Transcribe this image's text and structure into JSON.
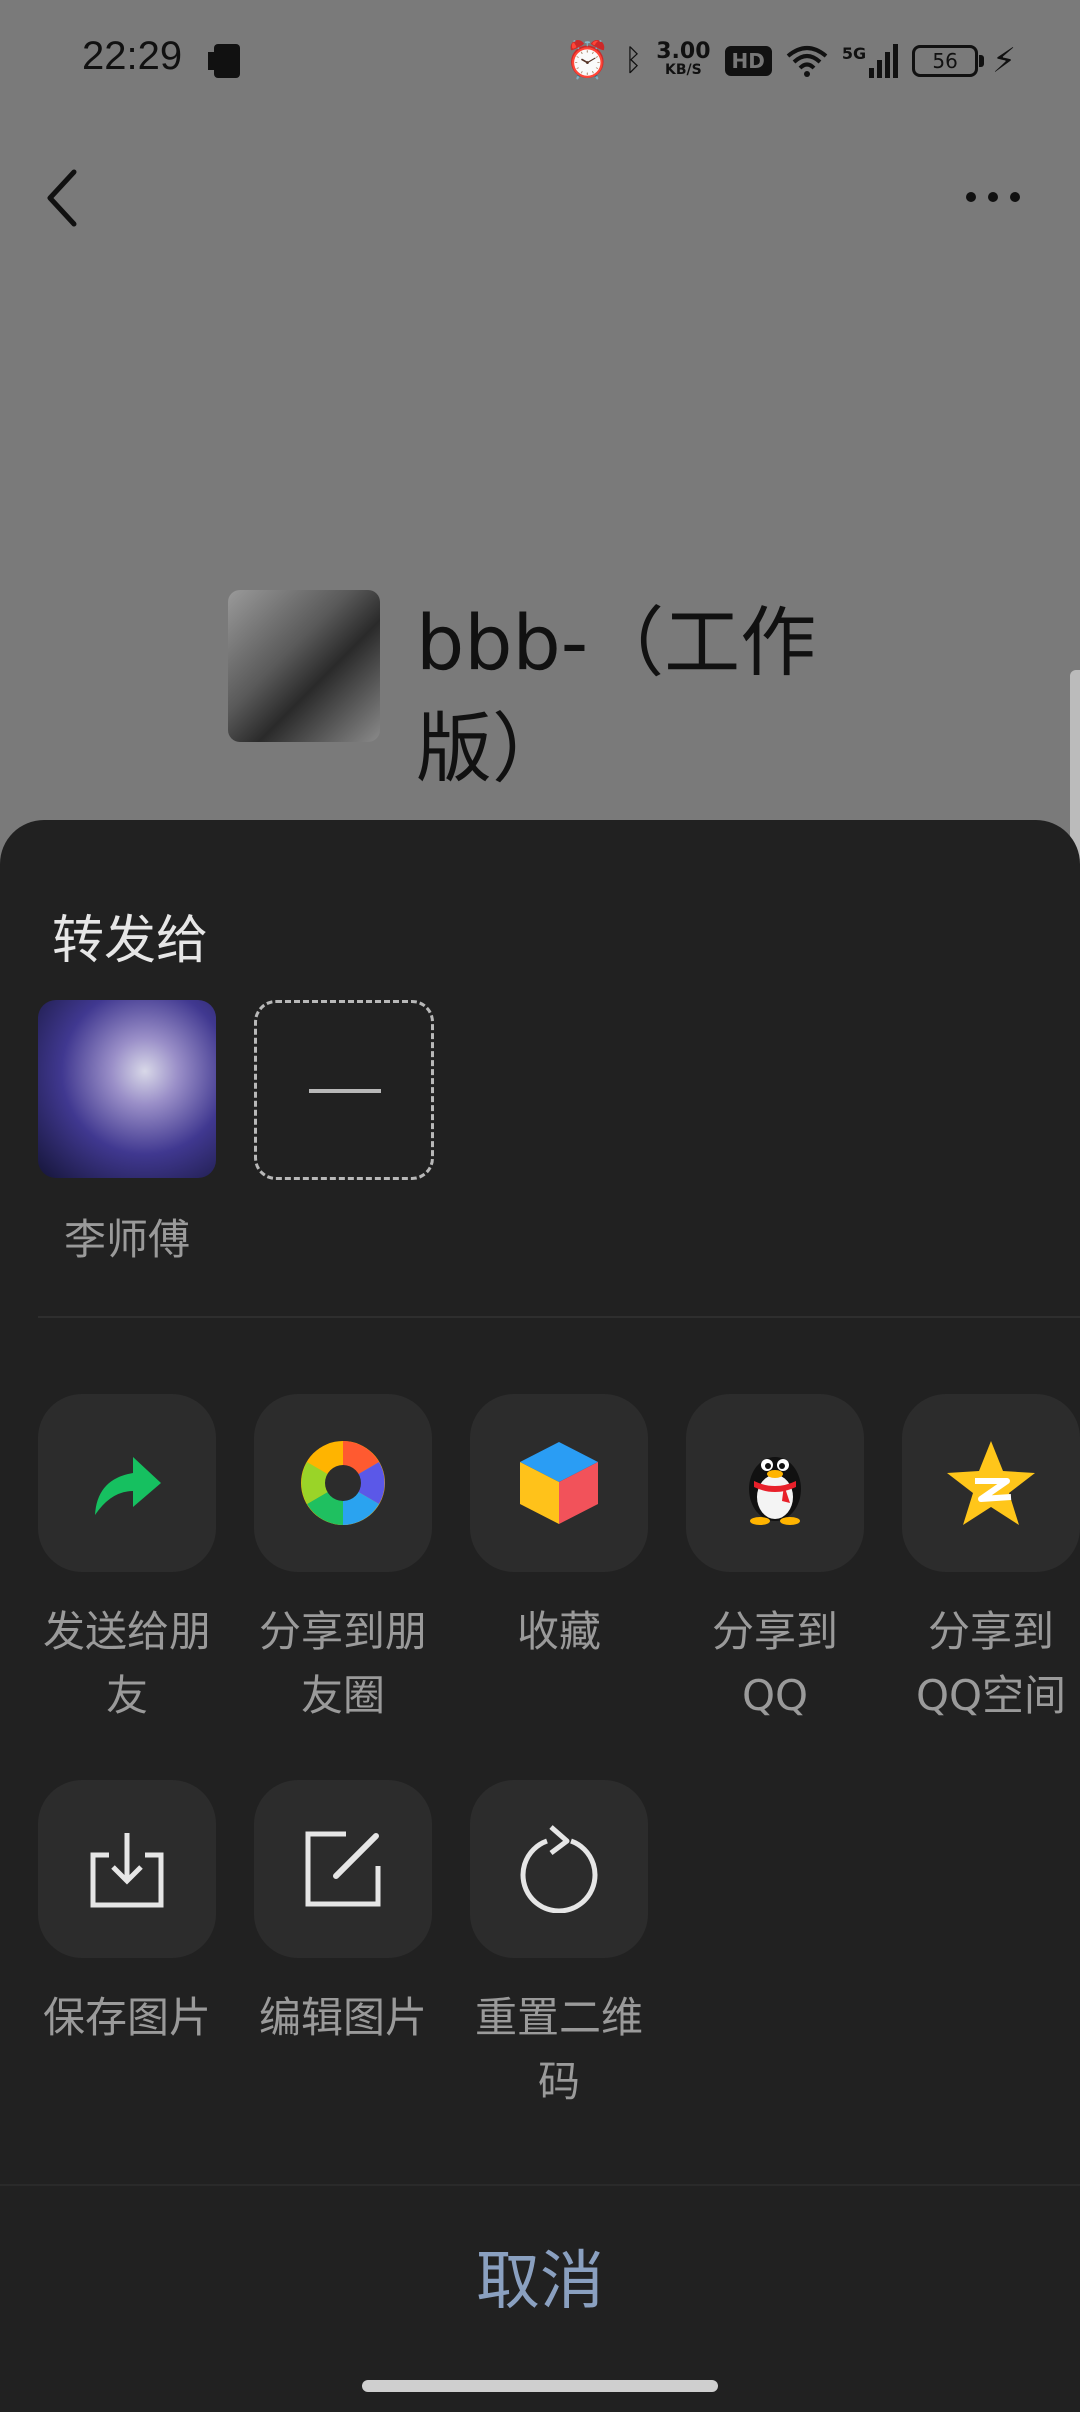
{
  "status_bar": {
    "time": "22:29",
    "net_speed_value": "3.00",
    "net_speed_unit": "KB/S",
    "hd_label": "HD",
    "network_label": "5G",
    "battery": "56"
  },
  "profile": {
    "name": "bbb-（工作版）"
  },
  "share_sheet": {
    "title": "转发给",
    "contacts": [
      {
        "name": "李师傅"
      }
    ],
    "actions_row1": [
      {
        "label": "发送给朋友",
        "icon": "forward-arrow-icon"
      },
      {
        "label": "分享到朋友圈",
        "icon": "moments-icon"
      },
      {
        "label": "收藏",
        "icon": "favorites-cube-icon"
      },
      {
        "label": "分享到QQ",
        "icon": "qq-penguin-icon"
      },
      {
        "label": "分享到QQ空间",
        "icon": "qzone-star-icon"
      }
    ],
    "actions_row2": [
      {
        "label": "保存图片",
        "icon": "download-icon"
      },
      {
        "label": "编辑图片",
        "icon": "edit-icon"
      },
      {
        "label": "重置二维码",
        "icon": "refresh-icon"
      }
    ],
    "cancel_label": "取消"
  },
  "colors": {
    "dim_background": "#7a7a7a",
    "sheet_background": "#212121",
    "tile_background": "#2c2c2c",
    "cancel_text": "#8aa0c0"
  }
}
